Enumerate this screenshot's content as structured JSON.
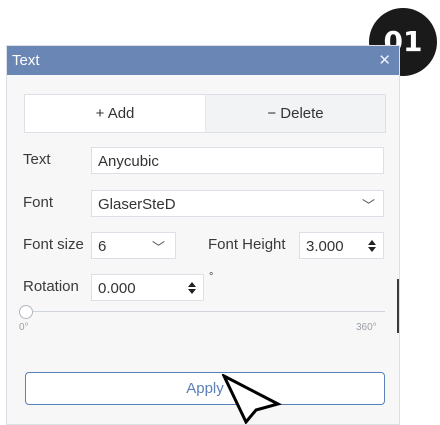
{
  "panel": {
    "title": "Text",
    "close_glyph": "✕"
  },
  "tabs": {
    "add": "+ Add",
    "delete": "− Delete"
  },
  "form": {
    "text_label": "Text",
    "text_value": "Anycubic",
    "font_label": "Font",
    "font_value": "GlaserSteD",
    "font_size_label": "Font size",
    "font_size_value": "6",
    "font_height_label": "Font Height",
    "font_height_value": "3.000",
    "rotation_label": "Rotation",
    "rotation_value": "0.000",
    "rotation_unit": "°"
  },
  "slider": {
    "min_label": "0°",
    "max_label": "360°",
    "value": 0
  },
  "apply_label": "Apply",
  "badge": "01",
  "colors": {
    "accent": "#6a86b4",
    "button": "#5b7fb8"
  },
  "icons": [
    "chevron-down-icon",
    "spinner-icon",
    "cursor-arrow-icon"
  ]
}
